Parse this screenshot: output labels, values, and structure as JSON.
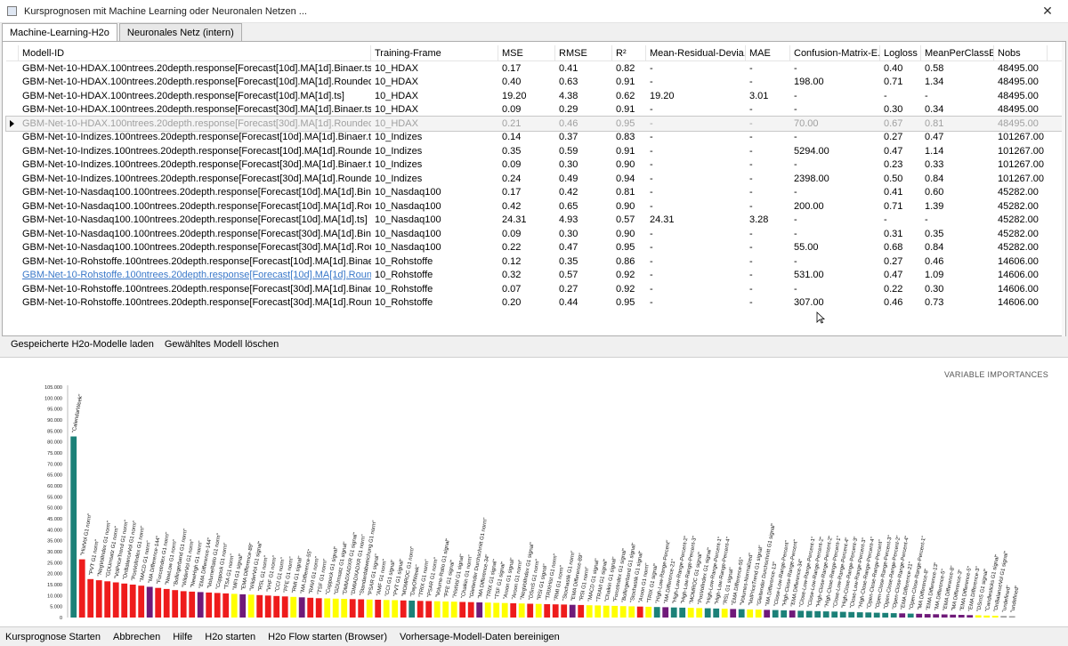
{
  "window": {
    "title": "Kursprognosen mit Machine Learning oder Neuronalen Netzen ...",
    "close_glyph": "✕"
  },
  "tabs": [
    {
      "label": "Machine-Learning-H2o",
      "active": true
    },
    {
      "label": "Neuronales Netz (intern)",
      "active": false
    }
  ],
  "table": {
    "headers": [
      "Modell-ID",
      "Training-Frame",
      "MSE",
      "RMSE",
      "R²",
      "Mean-Residual-Devia...",
      "MAE",
      "Confusion-Matrix-E...",
      "Logloss",
      "MeanPerClassErr...",
      "Nobs"
    ],
    "rows": [
      [
        "GBM-Net-10-HDAX.100ntrees.20depth.response[Forecast[10d].MA[1d].Binaer.ts]",
        "10_HDAX",
        "0.17",
        "0.41",
        "0.82",
        "-",
        "-",
        "-",
        "0.40",
        "0.58",
        "48495.00"
      ],
      [
        "GBM-Net-10-HDAX.100ntrees.20depth.response[Forecast[10d].MA[1d].Rounded.En...",
        "10_HDAX",
        "0.40",
        "0.63",
        "0.91",
        "-",
        "-",
        "198.00",
        "0.71",
        "1.34",
        "48495.00"
      ],
      [
        "GBM-Net-10-HDAX.100ntrees.20depth.response[Forecast[10d].MA[1d].ts]",
        "10_HDAX",
        "19.20",
        "4.38",
        "0.62",
        "19.20",
        "3.01",
        "-",
        "-",
        "-",
        "48495.00"
      ],
      [
        "GBM-Net-10-HDAX.100ntrees.20depth.response[Forecast[30d].MA[1d].Binaer.ts]",
        "10_HDAX",
        "0.09",
        "0.29",
        "0.91",
        "-",
        "-",
        "-",
        "0.30",
        "0.34",
        "48495.00"
      ],
      [
        "GBM-Net-10-HDAX.100ntrees.20depth.response[Forecast[30d].MA[1d].Rounded.En...",
        "10_HDAX",
        "0.21",
        "0.46",
        "0.95",
        "-",
        "-",
        "70.00",
        "0.67",
        "0.81",
        "48495.00"
      ],
      [
        "GBM-Net-10-Indizes.100ntrees.20depth.response[Forecast[10d].MA[1d].Binaer.ts]",
        "10_Indizes",
        "0.14",
        "0.37",
        "0.83",
        "-",
        "-",
        "-",
        "0.27",
        "0.47",
        "101267.00"
      ],
      [
        "GBM-Net-10-Indizes.100ntrees.20depth.response[Forecast[10d].MA[1d].Rounded.E...",
        "10_Indizes",
        "0.35",
        "0.59",
        "0.91",
        "-",
        "-",
        "5294.00",
        "0.47",
        "1.14",
        "101267.00"
      ],
      [
        "GBM-Net-10-Indizes.100ntrees.20depth.response[Forecast[30d].MA[1d].Binaer.ts]",
        "10_Indizes",
        "0.09",
        "0.30",
        "0.90",
        "-",
        "-",
        "-",
        "0.23",
        "0.33",
        "101267.00"
      ],
      [
        "GBM-Net-10-Indizes.100ntrees.20depth.response[Forecast[30d].MA[1d].Rounded.E...",
        "10_Indizes",
        "0.24",
        "0.49",
        "0.94",
        "-",
        "-",
        "2398.00",
        "0.50",
        "0.84",
        "101267.00"
      ],
      [
        "GBM-Net-10-Nasdaq100.100ntrees.20depth.response[Forecast[10d].MA[1d].Binaer....",
        "10_Nasdaq100",
        "0.17",
        "0.42",
        "0.81",
        "-",
        "-",
        "-",
        "0.41",
        "0.60",
        "45282.00"
      ],
      [
        "GBM-Net-10-Nasdaq100.100ntrees.20depth.response[Forecast[10d].MA[1d].Round...",
        "10_Nasdaq100",
        "0.42",
        "0.65",
        "0.90",
        "-",
        "-",
        "200.00",
        "0.71",
        "1.39",
        "45282.00"
      ],
      [
        "GBM-Net-10-Nasdaq100.100ntrees.20depth.response[Forecast[10d].MA[1d].ts]",
        "10_Nasdaq100",
        "24.31",
        "4.93",
        "0.57",
        "24.31",
        "3.28",
        "-",
        "-",
        "-",
        "45282.00"
      ],
      [
        "GBM-Net-10-Nasdaq100.100ntrees.20depth.response[Forecast[30d].MA[1d].Binaer....",
        "10_Nasdaq100",
        "0.09",
        "0.30",
        "0.90",
        "-",
        "-",
        "-",
        "0.31",
        "0.35",
        "45282.00"
      ],
      [
        "GBM-Net-10-Nasdaq100.100ntrees.20depth.response[Forecast[30d].MA[1d].Round...",
        "10_Nasdaq100",
        "0.22",
        "0.47",
        "0.95",
        "-",
        "-",
        "55.00",
        "0.68",
        "0.84",
        "45282.00"
      ],
      [
        "GBM-Net-10-Rohstoffe.100ntrees.20depth.response[Forecast[10d].MA[1d].Binaer.ts]",
        "10_Rohstoffe",
        "0.12",
        "0.35",
        "0.86",
        "-",
        "-",
        "-",
        "0.27",
        "0.46",
        "14606.00"
      ],
      [
        "GBM-Net-10-Rohstoffe.100ntrees.20depth.response[Forecast[10d].MA[1d].Rounded...",
        "10_Rohstoffe",
        "0.32",
        "0.57",
        "0.92",
        "-",
        "-",
        "531.00",
        "0.47",
        "1.09",
        "14606.00"
      ],
      [
        "GBM-Net-10-Rohstoffe.100ntrees.20depth.response[Forecast[30d].MA[1d].Binaer.ts]",
        "10_Rohstoffe",
        "0.07",
        "0.27",
        "0.92",
        "-",
        "-",
        "-",
        "0.22",
        "0.30",
        "14606.00"
      ],
      [
        "GBM-Net-10-Rohstoffe.100ntrees.20depth.response[Forecast[30d].MA[1d].Round...",
        "10_Rohstoffe",
        "0.20",
        "0.44",
        "0.95",
        "-",
        "-",
        "307.00",
        "0.46",
        "0.73",
        "14606.00"
      ]
    ],
    "selected_row": 4,
    "linked_row": 15
  },
  "actions": {
    "load_models": "Gespeicherte H2o-Modelle laden",
    "delete_model": "Gewähltes Modell löschen"
  },
  "bottom": [
    "Kursprognose Starten",
    "Abbrechen",
    "Hilfe",
    "H2o starten",
    "H2o Flow starten (Browser)",
    "Vorhersage-Modell-Daten bereinigen"
  ],
  "colors": {
    "teal": "#1c8178",
    "red": "#ee1c1c",
    "purple": "#6f1a79",
    "yellow": "#ffff00"
  },
  "chart_data": {
    "type": "bar",
    "title": "VARIABLE IMPORTANCES",
    "ylim": [
      0,
      105000
    ],
    "yticks": [
      "0",
      "5.000",
      "10.000",
      "15.000",
      "20.000",
      "25.000",
      "30.000",
      "35.000",
      "40.000",
      "45.000",
      "50.000",
      "55.000",
      "60.000",
      "65.000",
      "70.000",
      "75.000",
      "80.000",
      "85.000",
      "90.000",
      "95.000",
      "100.000",
      "105.000"
    ],
    "categories": [
      "CalendarWeek",
      "HistVol G1 norm",
      "PVT G1 norm",
      "NegVolIndex G1 norm",
      "GDUmsatz G1 norm",
      "VolPriceTrend G1 norm",
      "OnBalanceVol G1 norm",
      "PosVolIndex G1 norm",
      "MACD G1 norm",
      "MA Difference-144",
      "ForceIndex G1 norm",
      "NewLow G1 norm",
      "Bollingerband G1 norm",
      "WilderVol G1 norm",
      "NewHigh G1 norm",
      "EMA Difference-144",
      "VolumeRatio G1 norm",
      "Coppock G1 norm",
      "TSA G1 norm",
      "MFI G1 signal",
      "EMA Difference-89",
      "WilderVol G1 signal",
      "RSL G1 norm",
      "VHF G1 norm",
      "CCI G1 norm",
      "PFE G1 norm",
      "RMI G1 signal",
      "MA Difference-55",
      "RAVI G1 norm",
      "TSF G1 norm",
      "Coppock G1 signal",
      "GDUmsatz G1 signal",
      "DMIADXADXR G1 signal",
      "DMIADXADXR G1 norm",
      "Standardabweichung G1 norm",
      "PSAR G1 signal",
      "AMF G1 norm",
      "CCI G1 signal",
      "PVT G1 signal",
      "MOMROC G1 norm",
      "DayOfWeek",
      "TRIX G1 norm",
      "PSAR G1 norm",
      "Volume-Ratio G1 signal",
      "PFE G1 signal",
      "HistVol G1 signal",
      "Chaikin G1 norm",
      "Gleitender Durchschnitt G1 norm",
      "MA Difference-34",
      "TRIX G1 signal",
      "TSF G1 signal",
      "Aroon G1 signal",
      "Aroon G1 norm",
      "NegVolIndex G1 signal",
      "DSmS G1 norm",
      "RSI G1 signal",
      "TRIXHist G1 norm",
      "RMI G1 norm",
      "Stochastik G1 norm",
      "EMA Difference-89",
      "RSI G1 norm",
      "MACD G1 signal",
      "TRAVI G1 signal",
      "Chaikin G1 signal",
      "ForceIndex G1 signal",
      "Bollingerband G1 signal",
      "Stochastik G1 signal",
      "Aroon G1 norm",
      "TRIX G1 signal",
      "High-Low-Range-Percent",
      "MA Difference-21",
      "High-Low-Range-Percent-2",
      "High-Low-Range-Percent-3",
      "MOMROC G1 signal",
      "PosVolIndex G1 signal",
      "High-Low-Range-Percent-1",
      "High-Low-Range-Percent-4",
      "RSL G1 signal",
      "EMA Difference-55",
      "Volumes-Normalized",
      "VolPriceTrend G1 signal",
      "Gleitender Durchschnitt G1 signal",
      "MA Difference-13",
      "Close-Low-Range-Percent",
      "High-Close-Range-Percent",
      "EMA Difference-34",
      "Close-Low-Range-Percent-1",
      "Close-Low-Range-Percent-2",
      "High-Close-Range-Percent-2",
      "High-Close-Range-Percent-1",
      "Close-Low-Range-Percent-4",
      "High-Close-Range-Percent-3",
      "Close-Low-Range-Percent-3",
      "High-Close-Range-Percent-4",
      "Open-Close-Range-Percent",
      "Open-Close-Range-Percent-3",
      "Open-Close-Range-Percent-2",
      "Open-Close-Range-Percent-4",
      "EMA Difference-21",
      "Open-Close-Range-Percent-1",
      "MA Difference-8",
      "EMA Difference-13",
      "MA Difference-5",
      "EMA Difference-8",
      "MA Difference-3",
      "EMA Difference-5",
      "EMA Difference-3",
      "DSmS G1 signal",
      "Candlesticks G1 signal",
      "OnBalanceVol G1 signal"
    ],
    "values": [
      82500,
      26500,
      17500,
      17000,
      16500,
      16000,
      15500,
      15000,
      14500,
      14000,
      13500,
      13000,
      12500,
      12000,
      11800,
      11600,
      11400,
      11200,
      11000,
      10800,
      10600,
      10400,
      10200,
      10000,
      9800,
      9600,
      9400,
      9200,
      9000,
      8800,
      8700,
      8600,
      8500,
      8400,
      8300,
      8200,
      8100,
      8000,
      7900,
      7800,
      7700,
      7600,
      7500,
      7400,
      7300,
      7200,
      7100,
      7000,
      6900,
      6800,
      6700,
      6600,
      6500,
      6400,
      6300,
      6200,
      6100,
      6000,
      5900,
      5800,
      5700,
      5600,
      5500,
      5400,
      5300,
      5200,
      5100,
      5000,
      4900,
      4800,
      4700,
      4600,
      4500,
      4400,
      4300,
      4200,
      4100,
      4000,
      3900,
      3800,
      3700,
      3600,
      3500,
      3400,
      3300,
      3200,
      3100,
      3000,
      2900,
      2800,
      2700,
      2600,
      2500,
      2400,
      2300,
      2200,
      2100,
      2000,
      1900,
      1800,
      1700,
      1600,
      1500,
      1400,
      1300,
      1200,
      1100,
      1000,
      900,
      800,
      700,
      600
    ],
    "bar_colors": [
      "teal",
      "red",
      "red",
      "red",
      "red",
      "red",
      "red",
      "red",
      "red",
      "purple",
      "red",
      "red",
      "red",
      "red",
      "red",
      "purple",
      "red",
      "red",
      "red",
      "yellow",
      "purple",
      "yellow",
      "red",
      "red",
      "red",
      "red",
      "yellow",
      "purple",
      "red",
      "red",
      "yellow",
      "yellow",
      "yellow",
      "red",
      "red",
      "yellow",
      "red",
      "yellow",
      "yellow",
      "red",
      "teal",
      "red",
      "red",
      "yellow",
      "yellow",
      "yellow",
      "red",
      "red",
      "purple",
      "yellow",
      "yellow",
      "yellow",
      "red",
      "yellow",
      "red",
      "yellow",
      "red",
      "red",
      "red",
      "purple",
      "red",
      "yellow",
      "yellow",
      "yellow",
      "yellow",
      "yellow",
      "yellow",
      "red",
      "yellow",
      "teal",
      "purple",
      "teal",
      "teal",
      "yellow",
      "yellow",
      "teal",
      "teal",
      "yellow",
      "purple",
      "teal",
      "yellow",
      "yellow",
      "purple",
      "teal",
      "teal",
      "purple",
      "teal",
      "teal",
      "teal",
      "teal",
      "teal",
      "teal",
      "teal",
      "teal",
      "teal",
      "teal",
      "teal",
      "teal",
      "purple",
      "teal",
      "purple",
      "purple",
      "purple",
      "purple",
      "purple",
      "purple",
      "purple",
      "yellow",
      "yellow",
      "yellow"
    ],
    "grid": false,
    "legend": "none"
  }
}
